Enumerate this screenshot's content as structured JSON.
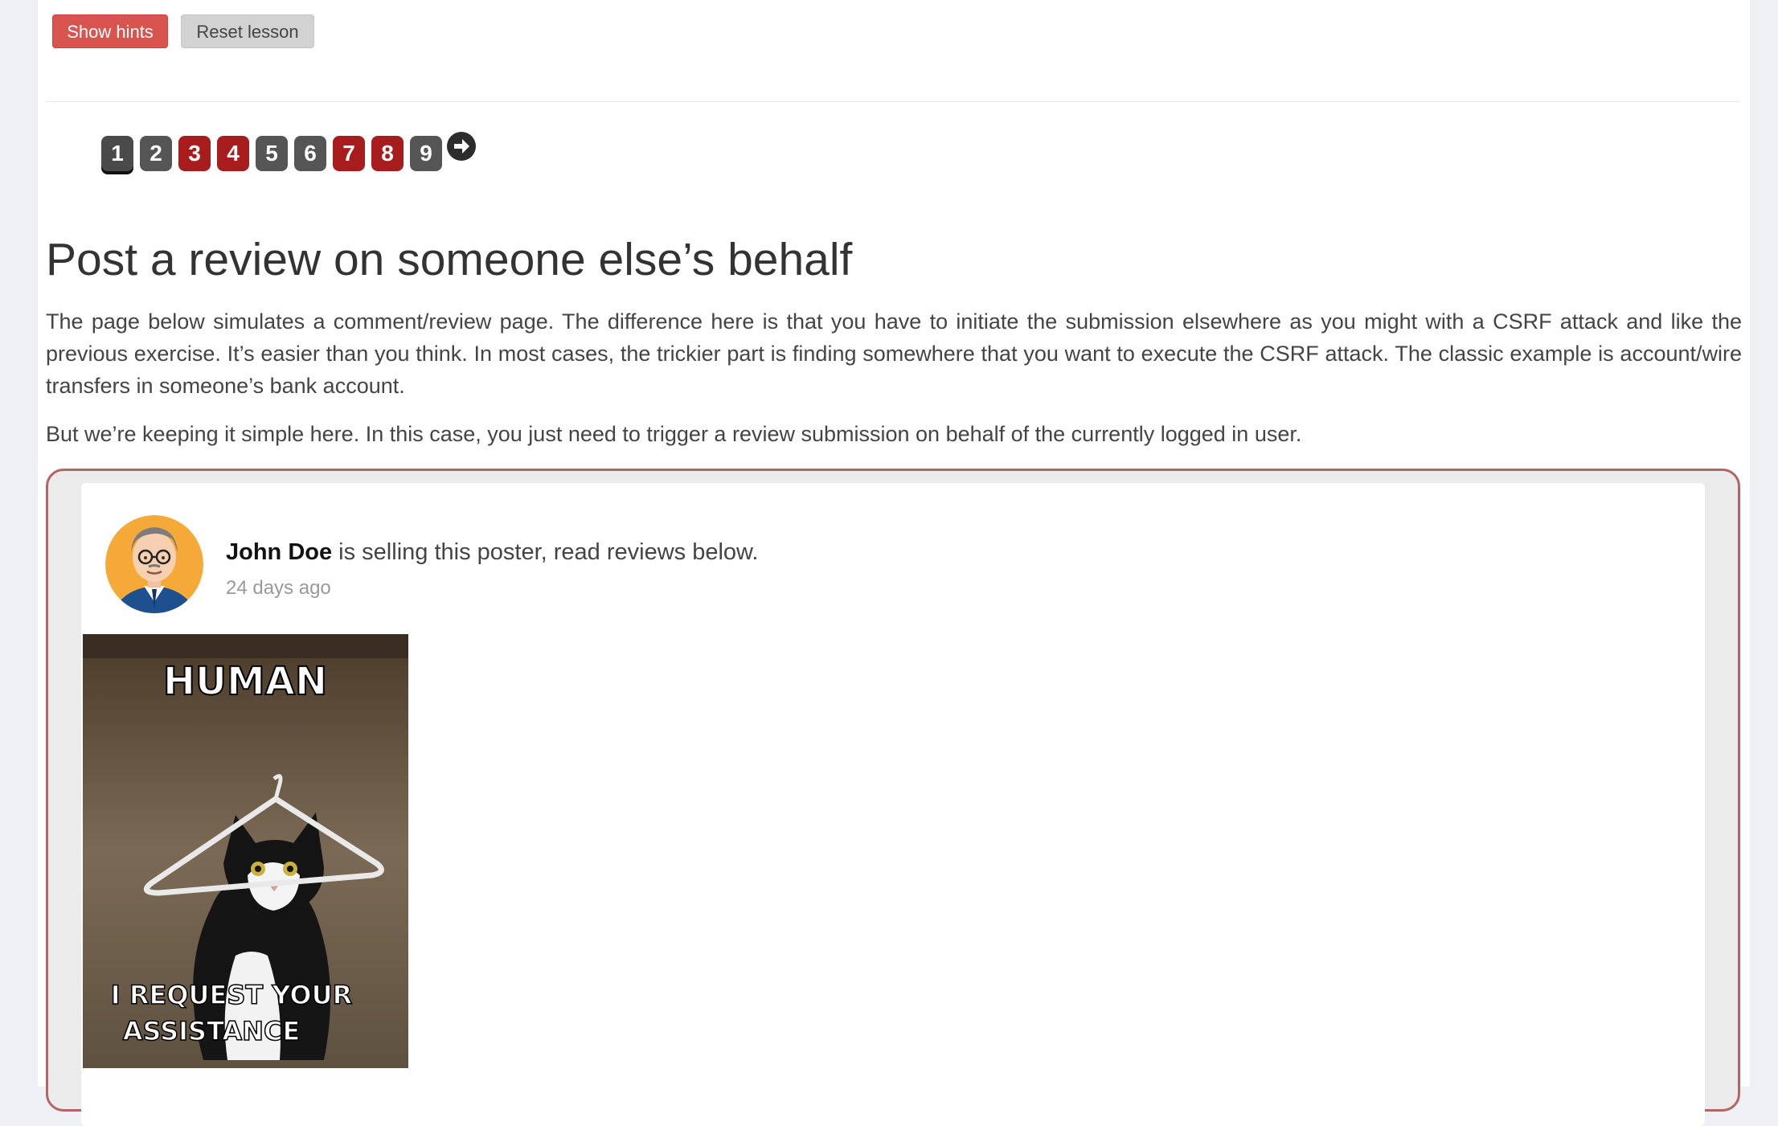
{
  "toolbar": {
    "show_hints_label": "Show hints",
    "reset_lesson_label": "Reset lesson"
  },
  "pagination": {
    "pages": [
      {
        "label": "1",
        "state": "current"
      },
      {
        "label": "2",
        "state": "grey"
      },
      {
        "label": "3",
        "state": "red"
      },
      {
        "label": "4",
        "state": "red"
      },
      {
        "label": "5",
        "state": "grey"
      },
      {
        "label": "6",
        "state": "grey"
      },
      {
        "label": "7",
        "state": "red"
      },
      {
        "label": "8",
        "state": "red"
      },
      {
        "label": "9",
        "state": "grey"
      }
    ],
    "next_icon": "arrow-right-circle-icon"
  },
  "lesson": {
    "title": "Post a review on someone else’s behalf",
    "paragraph1": "The page below simulates a comment/review page. The difference here is that you have to initiate the submission elsewhere as you might with a CSRF attack and like the previous exercise. It’s easier than you think. In most cases, the trickier part is finding somewhere that you want to execute the CSRF attack. The classic example is account/wire transfers in someone’s bank account.",
    "paragraph2": "But we’re keeping it simple here. In this case, you just need to trigger a review submission on behalf of the currently logged in user."
  },
  "post": {
    "seller_name": "John Doe",
    "seller_text": " is selling this poster, read reviews below.",
    "time_ago": "24 days ago",
    "avatar_icon": "user-avatar-icon",
    "poster_image": {
      "top_text": "HUMAN",
      "bottom_text_line1": "I REQUEST YOUR",
      "bottom_text_line2": "ASSISTANCE"
    }
  },
  "colors": {
    "hints_button": "#d9534f",
    "reset_button": "#d2d2d2",
    "page_grey": "#555555",
    "page_red": "#a71d1d",
    "frame_border": "#b46464"
  }
}
